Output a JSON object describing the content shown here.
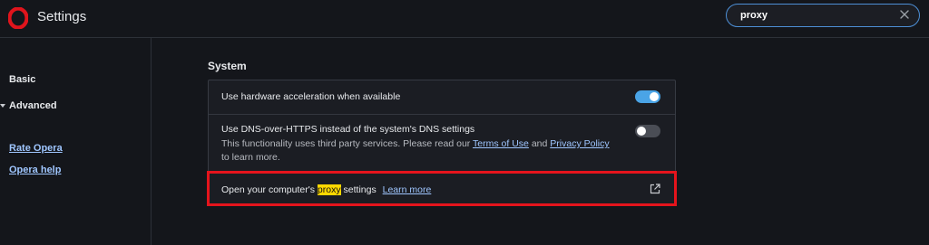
{
  "app": {
    "title": "Settings",
    "logo_icon": "opera-logo-icon",
    "brand_color": "#e0141c"
  },
  "search": {
    "value": "proxy",
    "clear_icon": "close-icon"
  },
  "sidebar": {
    "items": [
      {
        "label": "Basic"
      },
      {
        "label": "Advanced",
        "icon": "caret-down-icon"
      }
    ],
    "links": [
      {
        "label": "Rate Opera"
      },
      {
        "label": "Opera help"
      }
    ]
  },
  "system": {
    "title": "System",
    "hardware_acceleration": {
      "label": "Use hardware acceleration when available",
      "enabled": true
    },
    "dns": {
      "label": "Use DNS-over-HTTPS instead of the system's DNS settings",
      "desc_prefix": "This functionality uses third party services. Please read our",
      "terms_link": "Terms of Use",
      "and": "and",
      "privacy_link": "Privacy Policy",
      "desc_suffix": "to learn more.",
      "enabled": false
    },
    "proxy": {
      "label_before": "Open your computer's",
      "label_highlight": "proxy",
      "label_after": "settings",
      "learn_more": "Learn more",
      "icon": "external-link-icon"
    }
  },
  "colors": {
    "background": "#14161b",
    "accent": "#4aa4e6",
    "link": "#9fc6ff",
    "highlight": "#ffd800",
    "focus_outline": "#e5141c"
  }
}
